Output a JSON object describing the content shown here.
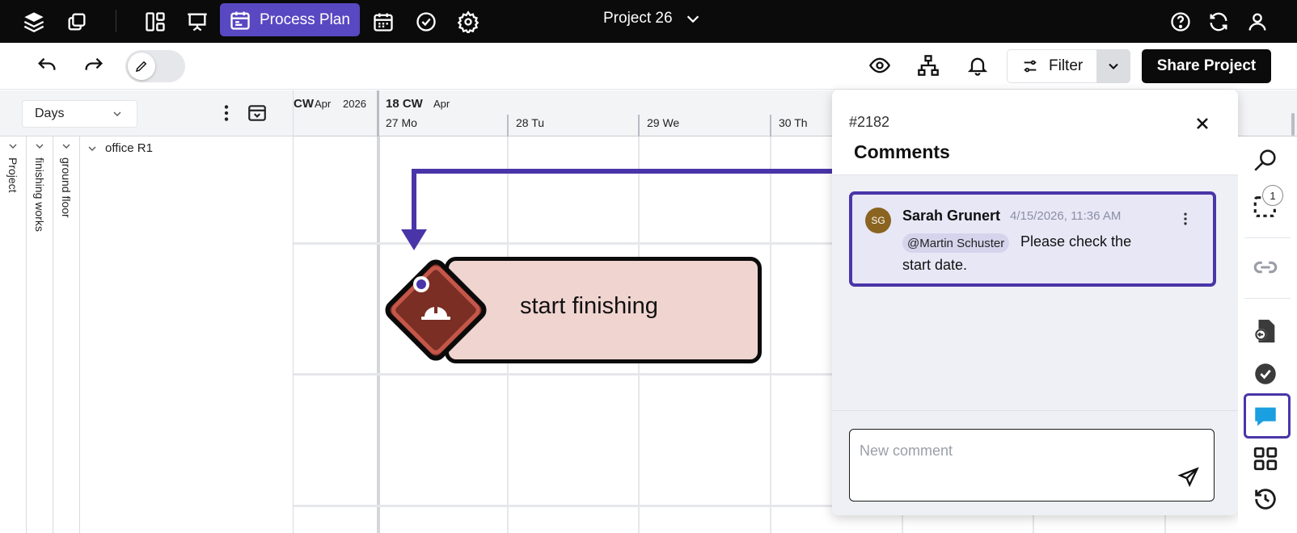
{
  "topnav": {
    "process_plan_label": "Process Plan",
    "project_title": "Project 26"
  },
  "toolbar": {
    "filter_label": "Filter",
    "share_label": "Share Project"
  },
  "left_panel": {
    "view_select_value": "Days",
    "columns": [
      "Project",
      "finishing works",
      "ground floor"
    ],
    "row_label": "office R1"
  },
  "timeline": {
    "prev_week_label": "CW",
    "prev_month": "Apr",
    "prev_year": "2026",
    "week_label": "18 CW",
    "month": "Apr",
    "days": [
      "27 Mo",
      "28 Tu",
      "29 We",
      "30 Th"
    ]
  },
  "task": {
    "label": "start finishing",
    "icon": "hard-hat-icon",
    "colors": {
      "fill": "#f0d4cf",
      "diamond": "#7a2e24",
      "diamond_border": "#c4574a"
    }
  },
  "comments_panel": {
    "id": "#2182",
    "title": "Comments",
    "comment": {
      "initials": "SG",
      "author": "Sarah Grunert",
      "timestamp": "4/15/2026, 11:36 AM",
      "mention": "@Martin Schuster",
      "text_line1": "Please check the",
      "text_line2": "start date."
    },
    "new_comment_placeholder": "New comment"
  },
  "rail": {
    "selection_badge": "1"
  },
  "colors": {
    "accent": "#5848c2",
    "highlight": "#4a35a8",
    "chat": "#1a9fe0"
  }
}
